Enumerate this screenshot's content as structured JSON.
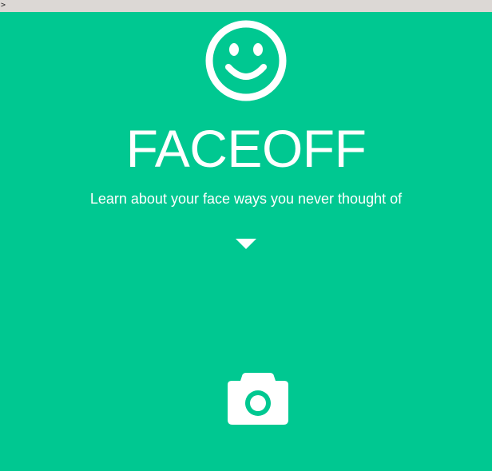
{
  "browser": {
    "prompt_text": ">"
  },
  "hero": {
    "logo_icon": "smiley-icon",
    "title": "FACEOFF",
    "tagline": "Learn about your face ways you never thought of",
    "scroll_icon": "chevron-down-icon",
    "capture_icon": "camera-icon"
  },
  "colors": {
    "background": "#00c891",
    "foreground": "#ffffff",
    "top_strip": "#dcd8d5"
  }
}
